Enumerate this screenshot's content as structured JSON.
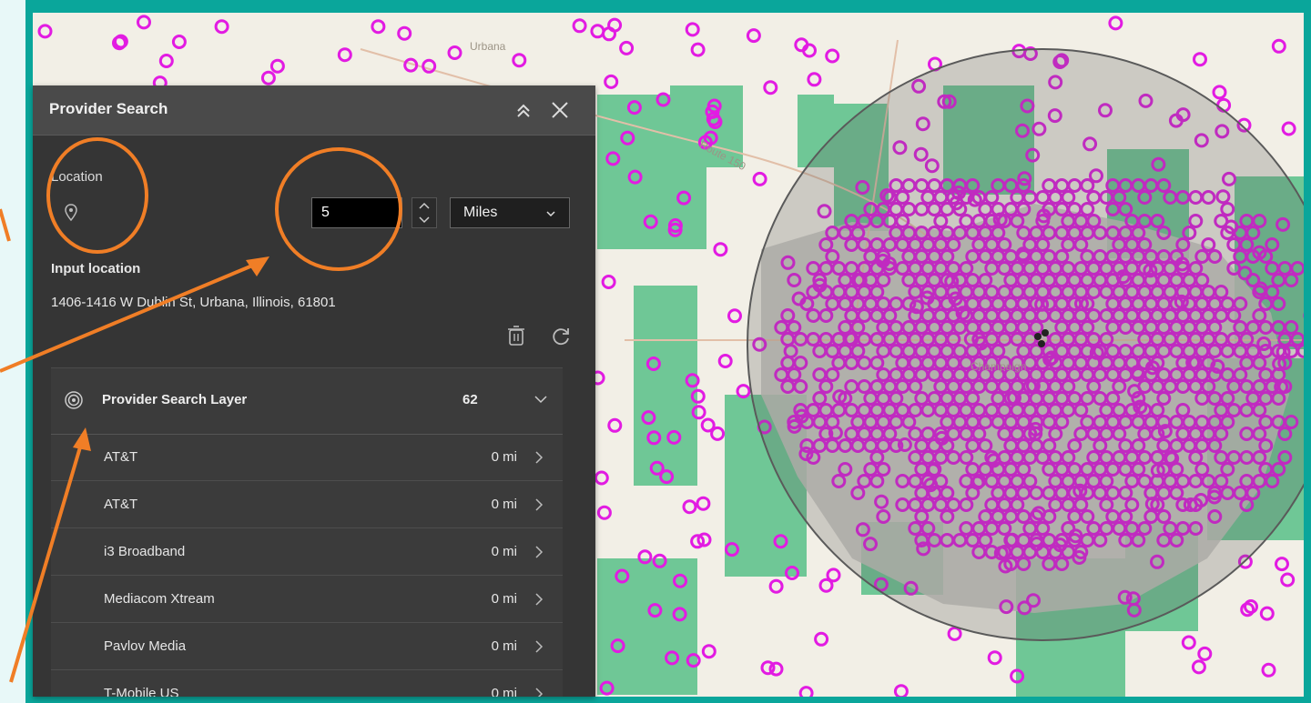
{
  "map": {
    "labels": [
      "Urbana",
      "Route 150",
      "Champaign",
      "Urbana"
    ],
    "colors": {
      "background": "#f2efe6",
      "green": "#6fc796",
      "gray": "#c8c6c0",
      "magenta": "#e21be2",
      "circle": "#7a7a7a"
    }
  },
  "panel": {
    "title": "Provider Search",
    "collapse_icon": "double-chevron-up-icon",
    "close_icon": "close-icon",
    "location_label": "Location",
    "location_icon": "map-pin-icon",
    "distance_value": "5",
    "units_value": "Miles",
    "input_location_label": "Input location",
    "input_location_value": "1406-1416 W Dublin St, Urbana, Illinois, 61801",
    "trash_icon": "trash-icon",
    "refresh_icon": "refresh-icon",
    "layer": {
      "icon": "layer-target-icon",
      "title": "Provider Search Layer",
      "count": "62",
      "items": [
        {
          "name": "AT&T",
          "distance": "0 mi"
        },
        {
          "name": "AT&T",
          "distance": "0 mi"
        },
        {
          "name": "i3 Broadband",
          "distance": "0 mi"
        },
        {
          "name": "Mediacom Xtream",
          "distance": "0 mi"
        },
        {
          "name": "Pavlov Media",
          "distance": "0 mi"
        },
        {
          "name": "T-Mobile US",
          "distance": "0 mi"
        }
      ]
    }
  },
  "annotation_color": "#f07e26"
}
